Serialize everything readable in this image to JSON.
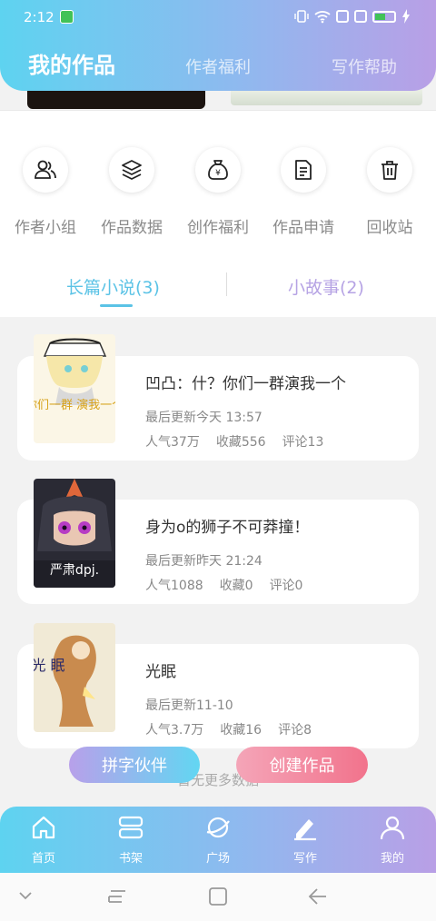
{
  "status_bar": {
    "time": "2:12"
  },
  "header": {
    "tabs": [
      {
        "label": "我的作品",
        "active": true
      },
      {
        "label": "作者福利",
        "active": false
      },
      {
        "label": "写作帮助",
        "active": false
      }
    ]
  },
  "quick_actions": [
    {
      "label": "作者小组",
      "icon": "group-icon"
    },
    {
      "label": "作品数据",
      "icon": "layers-icon"
    },
    {
      "label": "创作福利",
      "icon": "money-bag-icon"
    },
    {
      "label": "作品申请",
      "icon": "document-icon"
    },
    {
      "label": "回收站",
      "icon": "trash-icon"
    }
  ],
  "segments": [
    {
      "label": "长篇小说(3)",
      "active": true
    },
    {
      "label": "小故事(2)",
      "active": false
    }
  ],
  "works": [
    {
      "title": "凹凸：什？你们一群演我一个",
      "updated": "最后更新今天 13:57",
      "popularity": "人气37万",
      "favorites": "收藏556",
      "comments": "评论13",
      "cover_text": "你们一群 演我一个"
    },
    {
      "title": "身为o的狮子不可莽撞！",
      "updated": "最后更新昨天 21:24",
      "popularity": "人气1088",
      "favorites": "收藏0",
      "comments": "评论0",
      "cover_text": "严肃dpj."
    },
    {
      "title": "光眠",
      "updated": "最后更新11-10",
      "popularity": "人气3.7万",
      "favorites": "收藏16",
      "comments": "评论8",
      "cover_text": "光 眠"
    }
  ],
  "no_more_text": "暂无更多数据",
  "fab": {
    "partner_label": "拼字伙伴",
    "create_label": "创建作品"
  },
  "bottom_nav": [
    {
      "label": "首页",
      "icon": "home-icon"
    },
    {
      "label": "书架",
      "icon": "bookshelf-icon"
    },
    {
      "label": "广场",
      "icon": "planet-icon"
    },
    {
      "label": "写作",
      "icon": "pen-icon",
      "active": true
    },
    {
      "label": "我的",
      "icon": "profile-icon"
    }
  ],
  "colors": {
    "gradient_start": "#5ed3f0",
    "gradient_end": "#b99fe6",
    "segment_active": "#5bc3e6",
    "segment_inactive": "#b6a3e4",
    "create_button": "#f2738c"
  }
}
